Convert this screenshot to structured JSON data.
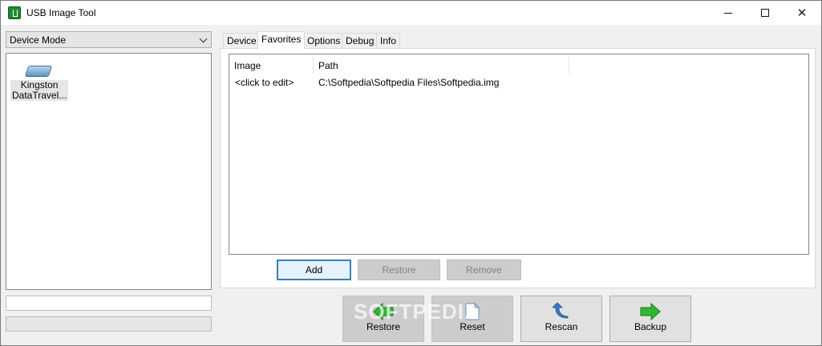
{
  "window": {
    "title": "USB Image Tool"
  },
  "left_panel": {
    "mode_select": {
      "value": "Device Mode"
    },
    "devices": [
      {
        "label_line1": "Kingston",
        "label_line2": "DataTravel..."
      }
    ]
  },
  "tabs": [
    {
      "label": "Device"
    },
    {
      "label": "Favorites"
    },
    {
      "label": "Options"
    },
    {
      "label": "Debug"
    },
    {
      "label": "Info"
    }
  ],
  "favorites": {
    "columns": [
      "Image",
      "Path"
    ],
    "rows": [
      {
        "image": "<click to edit>",
        "path": "C:\\Softpedia\\Softpedia Files\\Softpedia.img"
      }
    ],
    "buttons": {
      "add": "Add",
      "restore": "Restore",
      "remove": "Remove"
    }
  },
  "bottom_buttons": {
    "restore": "Restore",
    "reset": "Reset",
    "rescan": "Rescan",
    "backup": "Backup"
  },
  "watermark": "SOFTPEDIA",
  "colors": {
    "arrow_green": "#2fb82f",
    "rescan_blue": "#3b78c4",
    "primary_border": "#3c7fb1"
  }
}
